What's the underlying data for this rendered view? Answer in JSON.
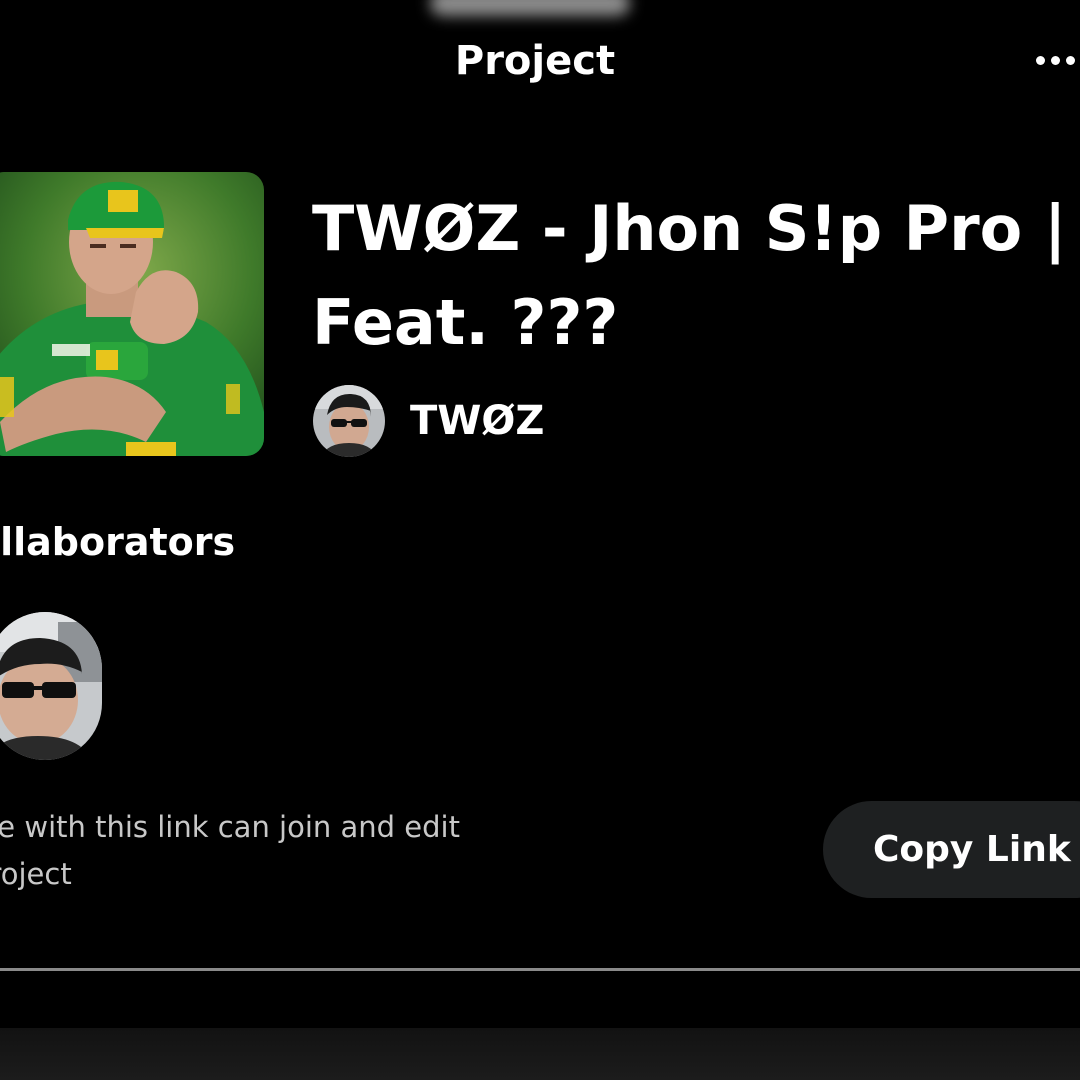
{
  "header": {
    "title": "Project",
    "more_icon": "more-horizontal-icon"
  },
  "project": {
    "cover_image": "album-cover",
    "title": "TWØZ  - Jhon S!p Pro | Feat. ???",
    "artist": {
      "avatar": "artist-avatar",
      "name": "TWØZ"
    }
  },
  "collaborators": {
    "heading": "ollaborators",
    "members": [
      {
        "avatar": "collaborator-avatar"
      }
    ]
  },
  "share": {
    "note": "yone with this link can join and edit\ne project",
    "button_label": "Copy Link"
  },
  "colors": {
    "background": "#000000",
    "button_background": "#1e2021",
    "secondary_text": "#c8c8c8",
    "divider": "#8a8a8a",
    "cover_green": "#4f8a2a"
  }
}
